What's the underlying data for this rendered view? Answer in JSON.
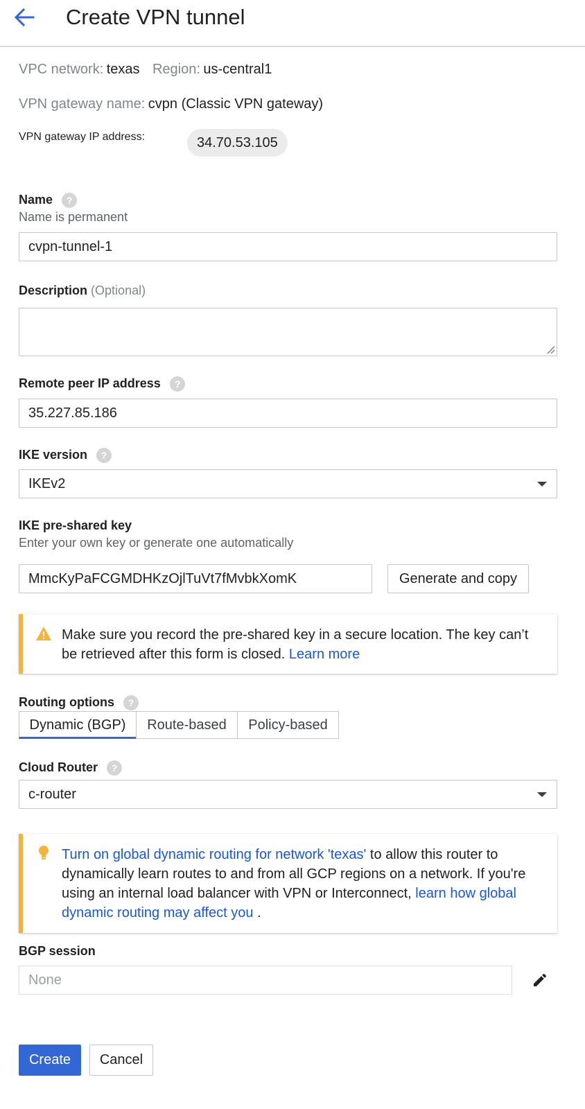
{
  "header": {
    "title": "Create VPN tunnel"
  },
  "meta": {
    "vpc_label": "VPC network:",
    "vpc_value": "texas",
    "region_label": "Region:",
    "region_value": "us-central1",
    "gateway_name_label": "VPN gateway name:",
    "gateway_name_value": "cvpn (Classic VPN gateway)",
    "gateway_ip_label": "VPN gateway IP address:",
    "gateway_ip_value": "34.70.53.105"
  },
  "name": {
    "label": "Name",
    "hint": "Name is permanent",
    "value": "cvpn-tunnel-1"
  },
  "description": {
    "label": "Description",
    "optional": "(Optional)",
    "value": ""
  },
  "remote_peer": {
    "label": "Remote peer IP address",
    "value": "35.227.85.186"
  },
  "ike_version": {
    "label": "IKE version",
    "value": "IKEv2"
  },
  "psk": {
    "label": "IKE pre-shared key",
    "hint": "Enter your own key or generate one automatically",
    "value": "MmcKyPaFCGMDHKzOjlTuVt7fMvbkXomK",
    "generate_label": "Generate and copy"
  },
  "warning": {
    "text": "Make sure you record the pre-shared key in a secure location. The key can’t be retrieved after this form is closed.",
    "link": "Learn more"
  },
  "routing": {
    "label": "Routing options",
    "options": [
      "Dynamic (BGP)",
      "Route-based",
      "Policy-based"
    ],
    "selected": "Dynamic (BGP)"
  },
  "cloud_router": {
    "label": "Cloud Router",
    "value": "c-router"
  },
  "tip": {
    "link1": "Turn on global dynamic routing for network 'texas'",
    "text1": " to allow this router to dynamically learn routes to and from all GCP regions on a network. If you're using an internal load balancer with VPN or Interconnect, ",
    "link2": "learn how global dynamic routing may affect you",
    "text2": " ."
  },
  "bgp": {
    "label": "BGP session",
    "value": "None"
  },
  "actions": {
    "create_label": "Create",
    "cancel_label": "Cancel"
  },
  "colors": {
    "primary": "#3367d6",
    "link": "#1a57d6",
    "warning": "#f3b33d",
    "icon_gray": "#bdbdbd"
  }
}
